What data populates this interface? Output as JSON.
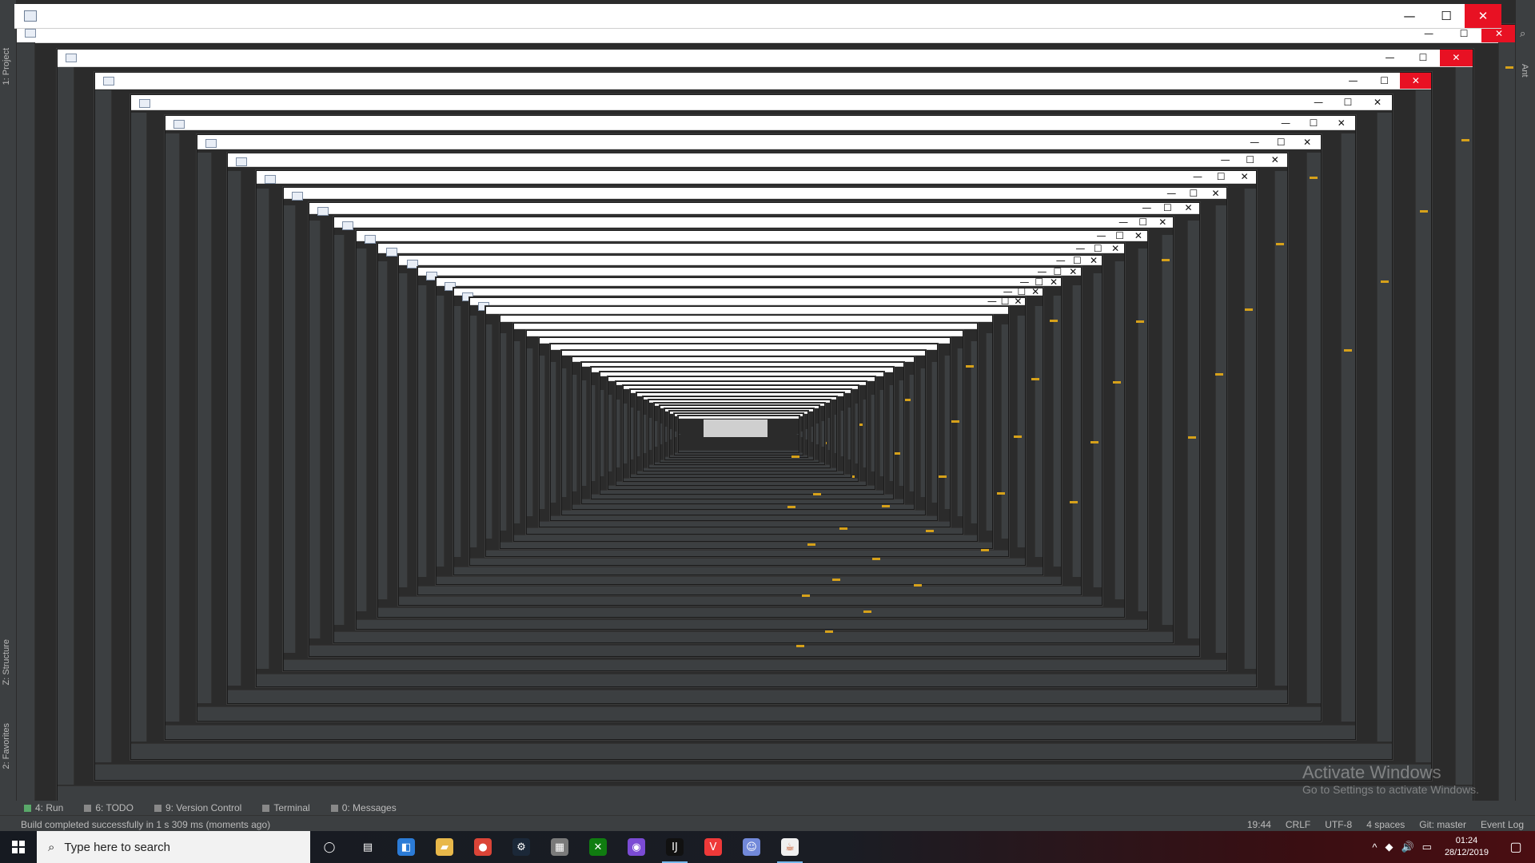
{
  "window": {
    "controls": {
      "minimize": "—",
      "maximize": "☐",
      "close": "✕"
    }
  },
  "sidebar_left": {
    "project_label": "1: Project",
    "structure_label": "Z: Structure",
    "favorites_label": "2: Favorites"
  },
  "sidebar_right": {
    "ant_label": "Ant"
  },
  "tool_windows": [
    {
      "label": "4: Run"
    },
    {
      "label": "6: TODO"
    },
    {
      "label": "9: Version Control"
    },
    {
      "label": "Terminal"
    },
    {
      "label": "0: Messages"
    }
  ],
  "status_bar": {
    "message": "Build completed successfully in 1 s 309 ms (moments ago)",
    "position": "19:44",
    "line_separator": "CRLF",
    "encoding": "UTF-8",
    "indent": "4 spaces",
    "vcs": "Git: master",
    "event_log": "Event Log"
  },
  "watermark": {
    "title": "Activate Windows",
    "subtitle": "Go to Settings to activate Windows."
  },
  "taskbar": {
    "search_placeholder": "Type here to search",
    "time": "01:24",
    "date": "28/12/2019",
    "apps": [
      {
        "name": "cortana-icon",
        "glyph": "◯",
        "color": "#00000000"
      },
      {
        "name": "task-view-icon",
        "glyph": "▤",
        "color": "#00000000"
      },
      {
        "name": "store-icon",
        "glyph": "◧",
        "color": "#2b7bd6"
      },
      {
        "name": "file-explorer-icon",
        "glyph": "▰",
        "color": "#e8b84a"
      },
      {
        "name": "chrome-icon",
        "glyph": "●",
        "color": "#db4437"
      },
      {
        "name": "steam-icon",
        "glyph": "⚙",
        "color": "#1b2838"
      },
      {
        "name": "app-icon",
        "glyph": "▦",
        "color": "#7a7a7a"
      },
      {
        "name": "xbox-icon",
        "glyph": "✕",
        "color": "#107c10"
      },
      {
        "name": "media-icon",
        "glyph": "◉",
        "color": "#7b4bd4"
      },
      {
        "name": "intellij-icon",
        "glyph": "IJ",
        "color": "#111111"
      },
      {
        "name": "vivaldi-icon",
        "glyph": "V",
        "color": "#ef3939"
      },
      {
        "name": "discord-icon",
        "glyph": "☺",
        "color": "#7289da"
      },
      {
        "name": "java-icon",
        "glyph": "☕",
        "color": "#f0f0f0"
      }
    ]
  }
}
